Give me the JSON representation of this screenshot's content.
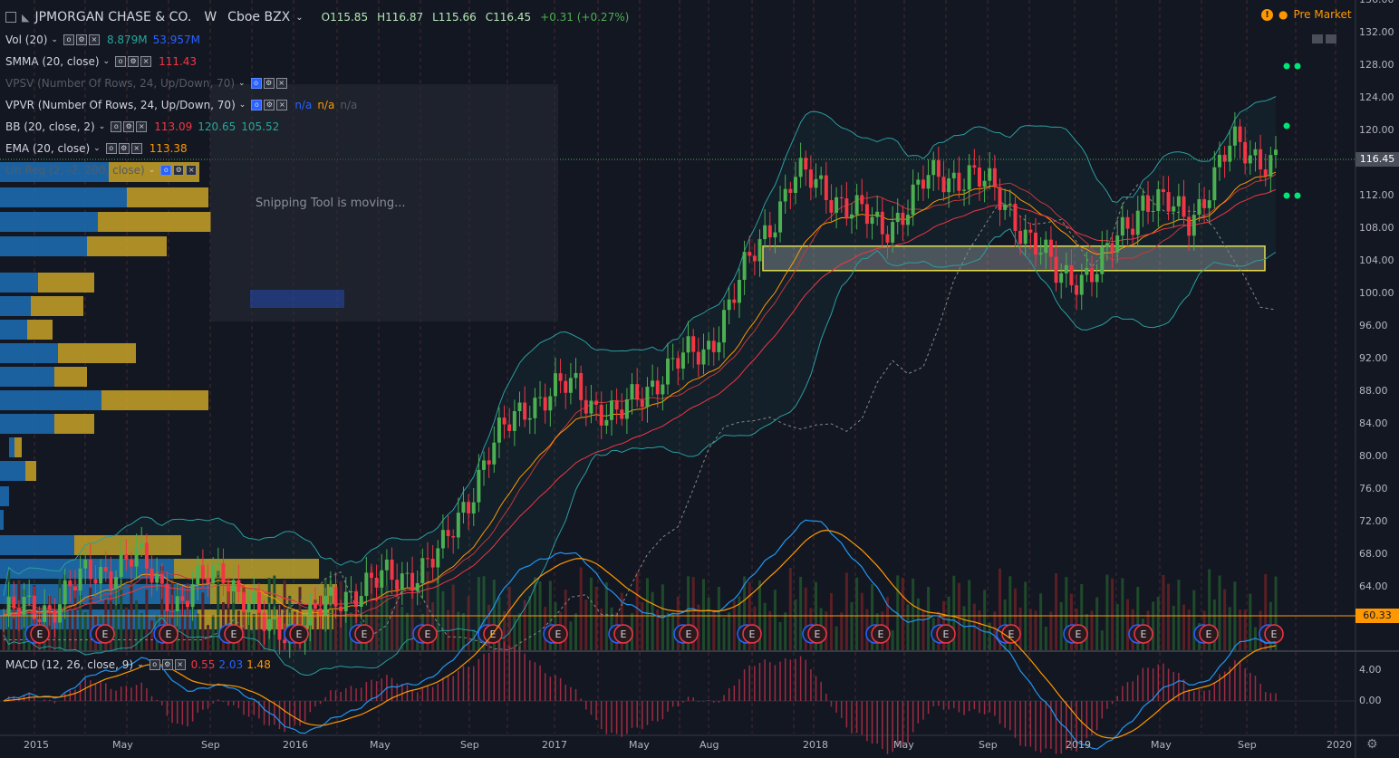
{
  "header": {
    "symbol": "JPMORGAN CHASE & CO.",
    "interval": "W",
    "exchange": "Cboe BZX",
    "open": "O115.85",
    "high": "H116.87",
    "low": "L115.66",
    "close": "C116.45",
    "change": "+0.31 (+0.27%)",
    "premarket": "Pre Market"
  },
  "indicators": [
    {
      "name": "Vol (20)",
      "v1": "8.879M",
      "v2": "53.957M",
      "c1": "#26a69a",
      "c2": "#2962ff"
    },
    {
      "name": "SMMA (20, close)",
      "v1": "111.43",
      "c1": "#f23645"
    },
    {
      "name": "VPSV (Number Of Rows, 24, Up/Down, 70)",
      "dim": true
    },
    {
      "name": "VPVR (Number Of Rows, 24, Up/Down, 70)",
      "v1": "n/a",
      "v2": "n/a",
      "v3": "n/a"
    },
    {
      "name": "BB (20, close, 2)",
      "v1": "113.09",
      "v2": "120.65",
      "v3": "105.52",
      "c1": "#f23645",
      "c2": "#26a69a",
      "c3": "#26a69a"
    },
    {
      "name": "EMA (20, close)",
      "v1": "113.38",
      "c1": "#ff9800"
    },
    {
      "name": "Lin Reg (2, -2, 200, close)",
      "dim": true
    }
  ],
  "macd": {
    "name": "MACD (12, 26, close, 9)",
    "v1": "0.55",
    "v2": "2.03",
    "v3": "1.48"
  },
  "overlay_text": "Snipping Tool is moving...",
  "price_axis": [
    "136.00",
    "132.00",
    "128.00",
    "124.00",
    "120.00",
    "116.00",
    "112.00",
    "108.00",
    "104.00",
    "100.00",
    "96.00",
    "92.00",
    "88.00",
    "84.00",
    "80.00",
    "76.00",
    "72.00",
    "68.00",
    "64.00"
  ],
  "last_price": "116.45",
  "line_price": "60.33",
  "macd_axis": [
    "4.00",
    "0.00"
  ],
  "time_axis": [
    "2015",
    "May",
    "Sep",
    "2016",
    "May",
    "Sep",
    "2017",
    "May",
    "Aug",
    "2018",
    "May",
    "Sep",
    "2019",
    "May",
    "Sep",
    "2020"
  ],
  "earnings_marker": "E",
  "colors": {
    "up": "#26a69a",
    "up_candle": "#4caf50",
    "down": "#f23645",
    "bg": "#131722",
    "grid": "#2a2e39",
    "bb": "#2a9ea0",
    "ema": "#ff9800",
    "smma": "#f23645",
    "vp_up": "#1e6fb5",
    "vp_down": "#c9a227"
  },
  "chart_data": {
    "type": "candlestick",
    "title": "JPMORGAN CHASE & CO., W, Cboe BZX",
    "x": [
      "2015-01",
      "2015-03",
      "2015-05",
      "2015-07",
      "2015-09",
      "2015-11",
      "2016-01",
      "2016-03",
      "2016-05",
      "2016-07",
      "2016-09",
      "2016-11",
      "2017-01",
      "2017-03",
      "2017-05",
      "2017-07",
      "2017-09",
      "2017-11",
      "2018-01",
      "2018-03",
      "2018-05",
      "2018-07",
      "2018-09",
      "2018-11",
      "2019-01",
      "2019-03",
      "2019-05",
      "2019-07",
      "2019-09",
      "2019-10"
    ],
    "close": [
      60.5,
      61.5,
      65.5,
      67.5,
      62,
      66.5,
      58.5,
      60,
      64,
      65,
      68,
      80,
      87,
      88.5,
      84.5,
      90.5,
      93,
      103.5,
      114.5,
      112,
      107.5,
      113.5,
      115,
      110,
      102,
      103,
      112,
      109,
      118,
      116.45
    ],
    "ylim": [
      60,
      137
    ],
    "highlight_zone": [
      102.8,
      105.8
    ]
  }
}
